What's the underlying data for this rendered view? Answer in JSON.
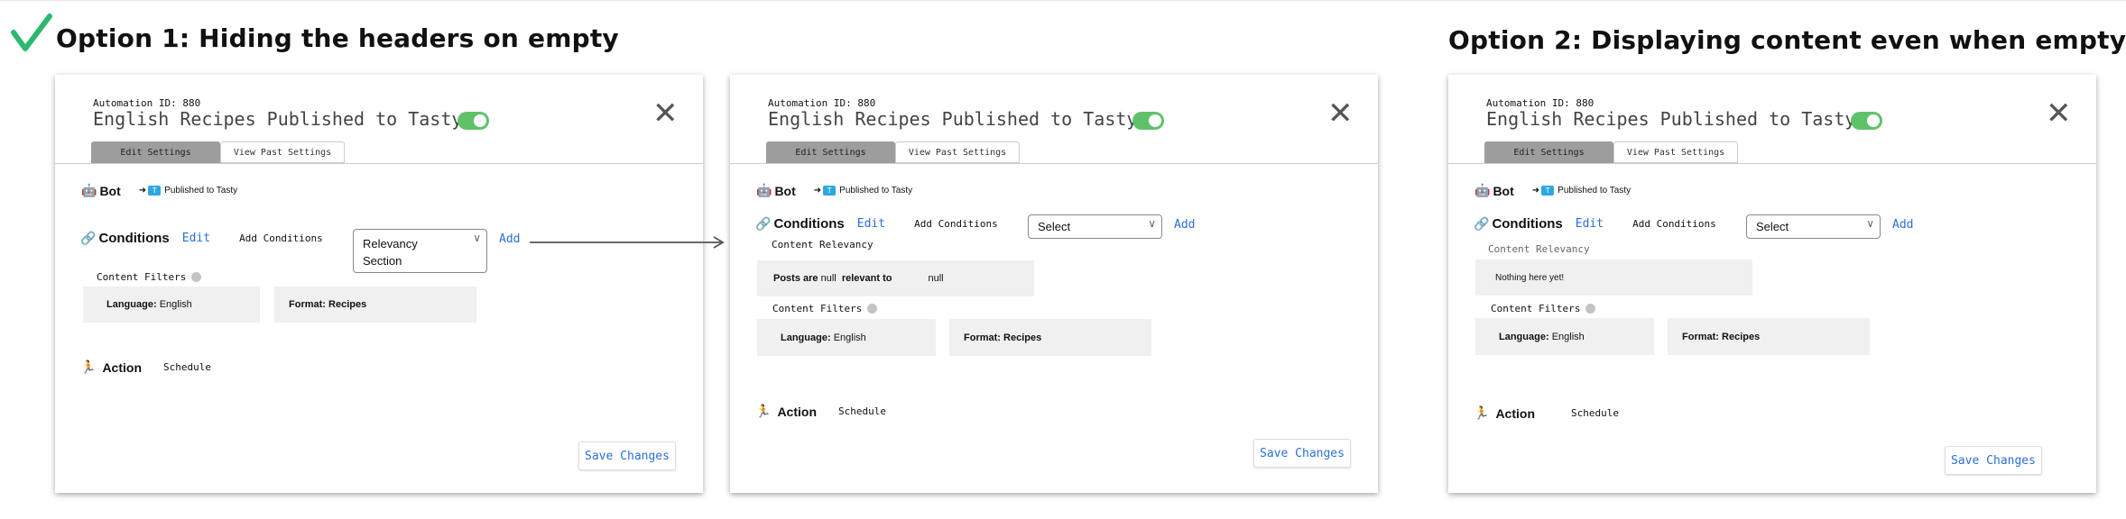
{
  "headings": {
    "option1": "Option 1: Hiding the headers on empty",
    "option2": "Option 2: Displaying content even when empty"
  },
  "colors": {
    "check": "#2db870",
    "toggle": "#5fc26b",
    "link": "#2b6fd6",
    "tab_active": "#9d9d9d"
  },
  "panel": {
    "automation_id_label": "Automation ID:",
    "automation_id": "880",
    "title": "English Recipes Published to Tasty",
    "close_icon": "✕",
    "tabs": {
      "edit": "Edit Settings",
      "past": "View Past Settings"
    },
    "bot_label": "Bot",
    "published": "Published to Tasty",
    "conditions_label": "Conditions",
    "edit_link": "Edit",
    "add_conditions": "Add Conditions",
    "add_link": "Add",
    "content_filters": "Content Filters",
    "content_relevancy": "Content Relevancy",
    "language_key": "Language:",
    "language_value": "English",
    "format_key": "Format:",
    "format_value": "Recipes",
    "action_label": "Action",
    "schedule": "Schedule",
    "save": "Save Changes"
  },
  "panel1": {
    "select_value_line1": "Relevancy",
    "select_value_line2": "Section"
  },
  "panel2": {
    "select_value": "Select",
    "relevancy_posts": "Posts are",
    "relevancy_null1": "null",
    "relevancy_mid": "relevant to",
    "relevancy_null2": "null"
  },
  "panel3": {
    "select_value": "Select",
    "empty_text": "Nothing here yet!"
  }
}
